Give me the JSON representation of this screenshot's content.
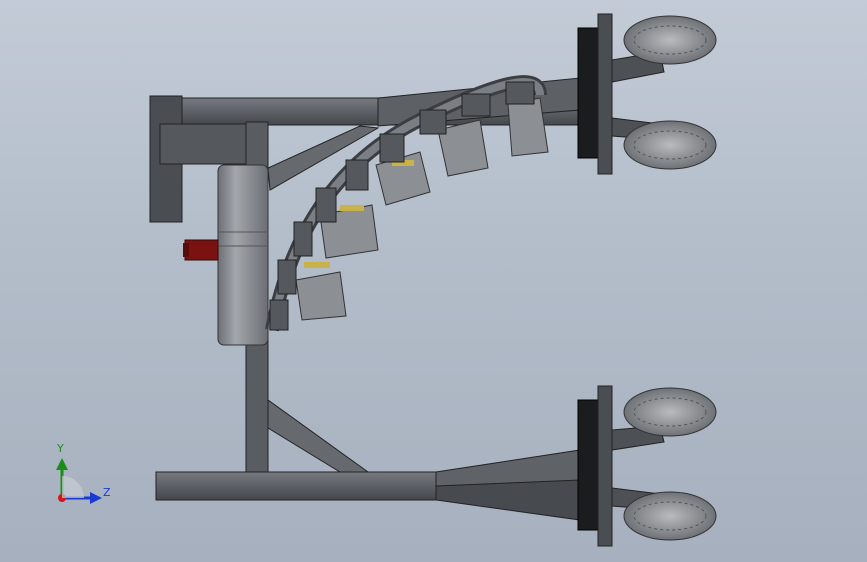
{
  "viewport": {
    "background_top": "#c2cbd6",
    "background_bottom": "#a6b0be"
  },
  "model": {
    "frame_color": "#5b5e62",
    "frame_dark": "#2d2f33",
    "frame_light": "#7d8086",
    "drum_color": "#8a8d93",
    "shaft_color": "#7a1212",
    "tire_color": "#8e9094",
    "spring_color": "#c9b24a"
  },
  "triad": {
    "y_axis_label": "Y",
    "z_axis_label": "Z",
    "y_color": "#1a8c1a",
    "z_color": "#1a3bd0",
    "x_color": "#d01818"
  }
}
